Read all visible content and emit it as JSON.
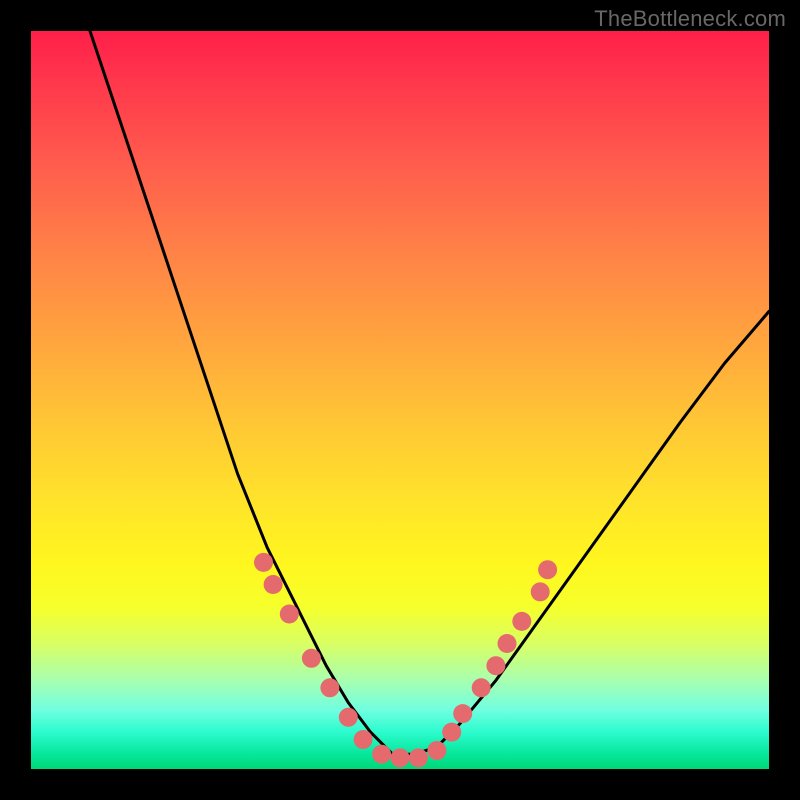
{
  "watermark": "TheBottleneck.com",
  "colors": {
    "frame": "#000000",
    "curve": "#000000",
    "marker": "#e46a6e",
    "gradient_top": "#ff1f4a",
    "gradient_bottom": "#00d876"
  },
  "chart_data": {
    "type": "line",
    "title": "",
    "xlabel": "",
    "ylabel": "",
    "xlim": [
      0,
      100
    ],
    "ylim": [
      0,
      100
    ],
    "series": [
      {
        "name": "bottleneck-curve",
        "x": [
          8,
          12,
          16,
          20,
          24,
          28,
          32,
          36,
          40,
          43,
          46,
          49,
          52,
          55,
          58,
          63,
          68,
          73,
          78,
          83,
          88,
          94,
          100
        ],
        "y": [
          100,
          88,
          76,
          64,
          52,
          40,
          30,
          22,
          14,
          9,
          5,
          2,
          2,
          3,
          6,
          12,
          19,
          26,
          33,
          40,
          47,
          55,
          62
        ]
      }
    ],
    "markers": [
      {
        "x": 31.5,
        "y": 28
      },
      {
        "x": 32.8,
        "y": 25
      },
      {
        "x": 35.0,
        "y": 21
      },
      {
        "x": 38.0,
        "y": 15
      },
      {
        "x": 40.5,
        "y": 11
      },
      {
        "x": 43.0,
        "y": 7
      },
      {
        "x": 45.0,
        "y": 4
      },
      {
        "x": 47.5,
        "y": 2
      },
      {
        "x": 50.0,
        "y": 1.5
      },
      {
        "x": 52.5,
        "y": 1.5
      },
      {
        "x": 55.0,
        "y": 2.5
      },
      {
        "x": 57.0,
        "y": 5
      },
      {
        "x": 58.5,
        "y": 7.5
      },
      {
        "x": 61.0,
        "y": 11
      },
      {
        "x": 63.0,
        "y": 14
      },
      {
        "x": 64.5,
        "y": 17
      },
      {
        "x": 66.5,
        "y": 20
      },
      {
        "x": 69.0,
        "y": 24
      },
      {
        "x": 70.0,
        "y": 27
      }
    ]
  }
}
